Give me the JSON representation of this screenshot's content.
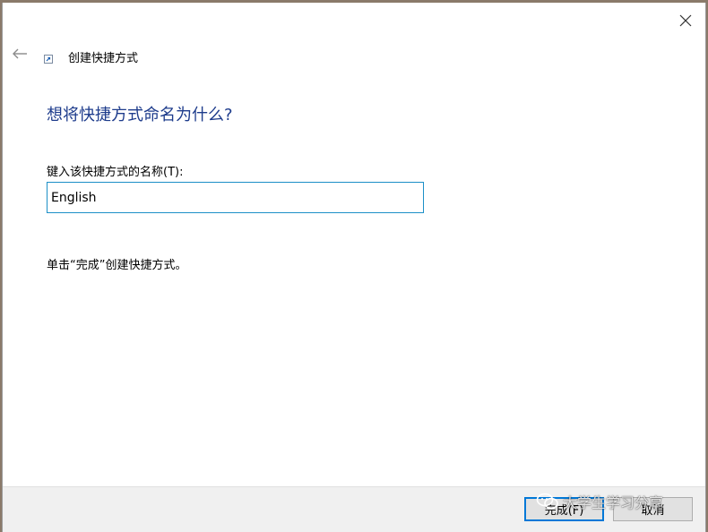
{
  "window": {
    "title": "创建快捷方式",
    "icons": {
      "close": "close-icon",
      "back": "back-arrow-icon",
      "wizard": "shortcut-icon"
    }
  },
  "main": {
    "heading": "想将快捷方式命名为什么?",
    "field_label": "键入该快捷方式的名称(T):",
    "name_value": "English",
    "instruction": "单击“完成”创建快捷方式。"
  },
  "footer": {
    "finish_label": "完成(F)",
    "cancel_label": "取消"
  },
  "watermark": {
    "text": "大学生学习分享",
    "icon": "wechat-icon"
  },
  "colors": {
    "heading": "#1e3c8c",
    "input_border": "#1c8fc7",
    "primary_button_border": "#0078d7",
    "footer_bg": "#f0f0f0"
  }
}
